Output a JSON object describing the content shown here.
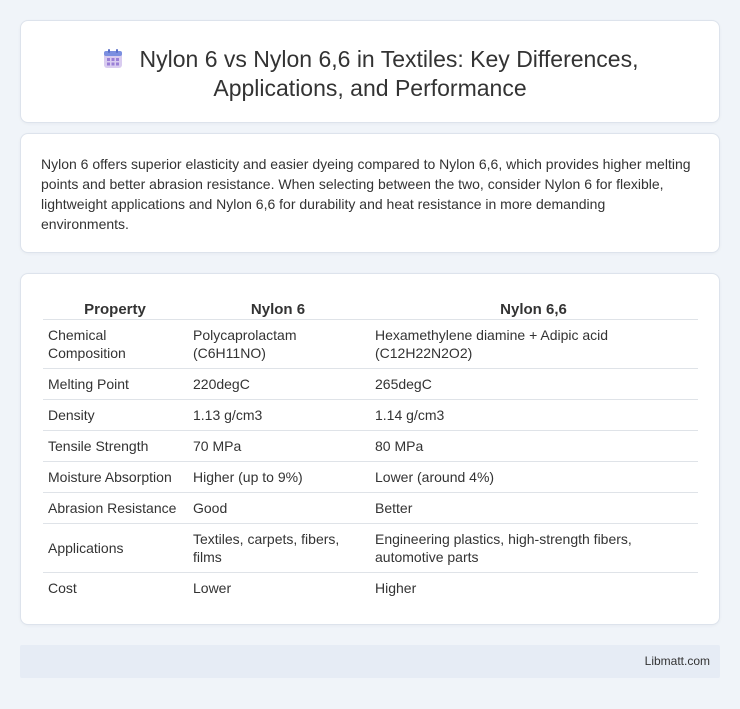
{
  "header": {
    "icon": "calendar-icon",
    "title_line1": "Nylon 6 vs Nylon 6,6 in Textiles: Key Differences,",
    "title_line2": "Applications, and Performance"
  },
  "summary": {
    "text": "Nylon 6 offers superior elasticity and easier dyeing compared to Nylon 6,6, which provides higher melting points and better abrasion resistance. When selecting between the two, consider Nylon 6 for flexible, lightweight applications and Nylon 6,6 for durability and heat resistance in more demanding environments."
  },
  "table": {
    "headers": [
      "Property",
      "Nylon 6",
      "Nylon 6,6"
    ],
    "rows": [
      [
        "Chemical Composition",
        "Polycaprolactam (C6H11NO)",
        "Hexamethylene diamine + Adipic acid (C12H22N2O2)"
      ],
      [
        "Melting Point",
        "220degC",
        "265degC"
      ],
      [
        "Density",
        "1.13 g/cm3",
        "1.14 g/cm3"
      ],
      [
        "Tensile Strength",
        "70 MPa",
        "80 MPa"
      ],
      [
        "Moisture Absorption",
        "Higher (up to 9%)",
        "Lower (around 4%)"
      ],
      [
        "Abrasion Resistance",
        "Good",
        "Better"
      ],
      [
        "Applications",
        "Textiles, carpets, fibers, films",
        "Engineering plastics, high-strength fibers, automotive parts"
      ],
      [
        "Cost",
        "Lower",
        "Higher"
      ]
    ]
  },
  "footer": {
    "text": "Libmatt.com"
  }
}
